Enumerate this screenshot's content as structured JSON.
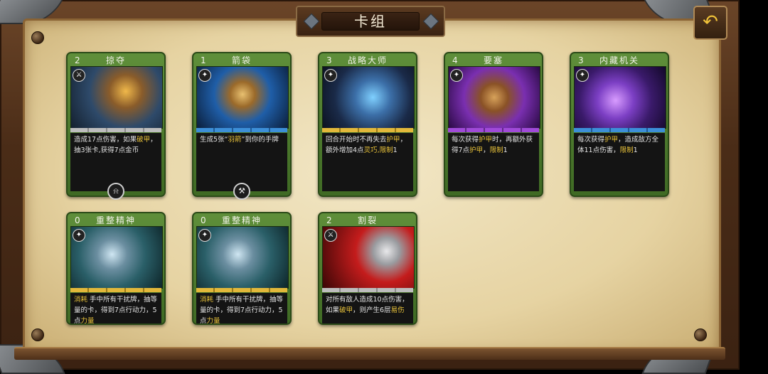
{
  "header": {
    "title": "卡组",
    "back_icon": "back-arrow-icon"
  },
  "colors": {
    "keyword": "#e8c23a",
    "card_frame": "#4f7c2e",
    "desc_bg": "#141414",
    "accent_gold": "#f2c43a"
  },
  "cards": [
    {
      "cost": "2",
      "name": "掠夺",
      "type_icon": "sword-icon",
      "bar": "gray",
      "desc": [
        {
          "t": "造成17点伤害，如果"
        },
        {
          "t": "破甲",
          "kw": true
        },
        {
          "t": "，抽3张卡,获得7点金币"
        }
      ],
      "badge": "bell-icon"
    },
    {
      "cost": "1",
      "name": "箭袋",
      "type_icon": "sparkle-icon",
      "bar": "blue",
      "desc": [
        {
          "t": "生成5张“"
        },
        {
          "t": "羽箭",
          "kw": true
        },
        {
          "t": "”到你的手牌"
        }
      ],
      "badge": "crossed-tools-icon"
    },
    {
      "cost": "3",
      "name": "战略大师",
      "type_icon": "sparkle-icon",
      "bar": "gold",
      "desc": [
        {
          "t": "回合开始时不再失去"
        },
        {
          "t": "护甲",
          "kw": true
        },
        {
          "t": "，额外增加4点"
        },
        {
          "t": "灵巧",
          "kw": true
        },
        {
          "t": ",限制",
          "kw": true
        },
        {
          "t": "1"
        }
      ]
    },
    {
      "cost": "4",
      "name": "要塞",
      "type_icon": "sparkle-icon",
      "bar": "purple",
      "desc": [
        {
          "t": "每次获得"
        },
        {
          "t": "护甲",
          "kw": true
        },
        {
          "t": "时，再额外获得7点"
        },
        {
          "t": "护甲",
          "kw": true
        },
        {
          "t": "，"
        },
        {
          "t": "限制",
          "kw": true
        },
        {
          "t": "1"
        }
      ]
    },
    {
      "cost": "3",
      "name": "内藏机关",
      "type_icon": "sparkle-icon",
      "bar": "blue",
      "desc": [
        {
          "t": "每次获得"
        },
        {
          "t": "护甲",
          "kw": true
        },
        {
          "t": "，造成敌方全体11点伤害，"
        },
        {
          "t": "限制",
          "kw": true
        },
        {
          "t": "1"
        }
      ]
    },
    {
      "cost": "0",
      "name": "重整精神",
      "type_icon": "sparkle-icon",
      "bar": "gold",
      "desc": [
        {
          "t": "消耗",
          "kw": true
        },
        {
          "t": " 手中所有干扰牌，抽等量的卡，得到7点行动力，5点"
        },
        {
          "t": "力量",
          "kw": true
        }
      ]
    },
    {
      "cost": "0",
      "name": "重整精神",
      "type_icon": "sparkle-icon",
      "bar": "gold",
      "desc": [
        {
          "t": "消耗",
          "kw": true
        },
        {
          "t": " 手中所有干扰牌，抽等量的卡，得到7点行动力，5点"
        },
        {
          "t": "力量",
          "kw": true
        }
      ]
    },
    {
      "cost": "2",
      "name": "割裂",
      "type_icon": "sword-icon",
      "bar": "gray",
      "desc": [
        {
          "t": "对所有敌人造成10点伤害，如果"
        },
        {
          "t": "破甲",
          "kw": true
        },
        {
          "t": "，则产生6层"
        },
        {
          "t": "易伤",
          "kw": true
        }
      ]
    }
  ]
}
